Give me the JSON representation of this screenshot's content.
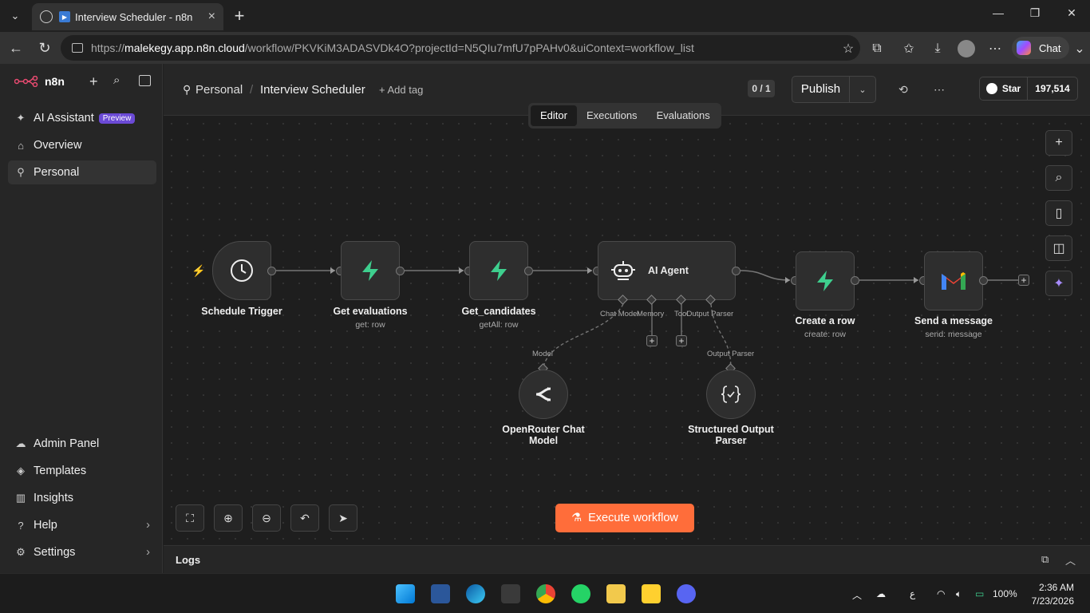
{
  "browser": {
    "tab_title": "Interview Scheduler - n8n",
    "url_host": "malekegy.app.n8n.cloud",
    "url_prefix": "https://",
    "url_path": "/workflow/PKVKiM3ADASVDk4O?projectId=N5QIu7mfU7pPAHv0&uiContext=workflow_list",
    "chat_label": "Chat"
  },
  "sidebar": {
    "brand": "n8n",
    "items_top": [
      {
        "label": "AI Assistant",
        "badge": "Preview"
      },
      {
        "label": "Overview"
      },
      {
        "label": "Personal"
      }
    ],
    "items_bottom": [
      {
        "label": "Admin Panel"
      },
      {
        "label": "Templates"
      },
      {
        "label": "Insights"
      },
      {
        "label": "Help"
      },
      {
        "label": "Settings"
      }
    ]
  },
  "header": {
    "project": "Personal",
    "separator": "/",
    "workflow_name": "Interview Scheduler",
    "add_tag": "+ Add tag",
    "counter": "0 / 1",
    "publish": "Publish",
    "github_star": "Star",
    "github_count": "197,514"
  },
  "view_tabs": [
    "Editor",
    "Executions",
    "Evaluations"
  ],
  "nodes": {
    "schedule": {
      "label": "Schedule Trigger"
    },
    "get_evaluations": {
      "label": "Get evaluations",
      "sub": "get: row"
    },
    "get_candidates": {
      "label": "Get_candidates",
      "sub": "getAll: row"
    },
    "ai_agent": {
      "label": "AI Agent",
      "ports": [
        "Chat Model",
        "Memory",
        "Tool",
        "Output Parser"
      ]
    },
    "create_row": {
      "label": "Create a row",
      "sub": "create: row"
    },
    "send_message": {
      "label": "Send a message",
      "sub": "send: message"
    },
    "openrouter": {
      "label": "OpenRouter Chat Model",
      "port": "Model"
    },
    "structured": {
      "label": "Structured Output Parser",
      "port": "Output Parser"
    }
  },
  "execute_label": "Execute workflow",
  "logs_label": "Logs",
  "taskbar": {
    "battery": "100%",
    "time": "2:36 AM",
    "date": "7/23/2026",
    "lang": "ع"
  },
  "colors": {
    "accent": "#ff6d3a",
    "node_green": "#3ecf8e",
    "preview_badge": "#6b4ad6"
  }
}
